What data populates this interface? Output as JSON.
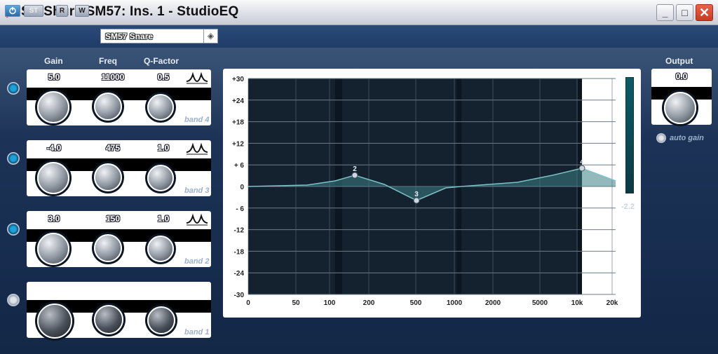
{
  "window": {
    "title": "SN Shure SM57: Ins. 1 - StudioEQ",
    "minimize": "_",
    "maximize": "□",
    "close": "✕"
  },
  "toolbar": {
    "bypass_icon": "power-icon",
    "st_label": "ST",
    "read_label": "R",
    "write_label": "W",
    "preset_value": "SM57 Snare",
    "preset_arrow": "◈"
  },
  "columns": {
    "gain": "Gain",
    "freq": "Freq",
    "q": "Q-Factor"
  },
  "bands": [
    {
      "name": "band 4",
      "gain": "5.0",
      "freq": "11000",
      "q": "0.5",
      "active": true
    },
    {
      "name": "band 3",
      "gain": "-4.0",
      "freq": "475",
      "q": "1.0",
      "active": true
    },
    {
      "name": "band 2",
      "gain": "3.0",
      "freq": "150",
      "q": "1.0",
      "active": true
    },
    {
      "name": "band 1",
      "gain": "",
      "freq": "",
      "q": "",
      "active": false
    }
  ],
  "output": {
    "label": "Output",
    "value": "0.0",
    "auto_gain": "auto gain",
    "meter_value": "-2.2"
  },
  "chart_data": {
    "type": "line",
    "y_ticks": [
      "+30",
      "+24",
      "+18",
      "+12",
      "+ 6",
      "0",
      "- 6",
      "-12",
      "-18",
      "-24",
      "-30"
    ],
    "x_ticks": [
      "0",
      "50",
      "100",
      "200",
      "500",
      "1000",
      "2000",
      "5000",
      "10k",
      "20k"
    ],
    "ylim": [
      -30,
      30
    ],
    "points": [
      {
        "label": "2",
        "gain": 3
      },
      {
        "label": "3",
        "gain": -4
      },
      {
        "label": "4",
        "gain": 5
      }
    ],
    "curve_color": "#3c7f86"
  }
}
